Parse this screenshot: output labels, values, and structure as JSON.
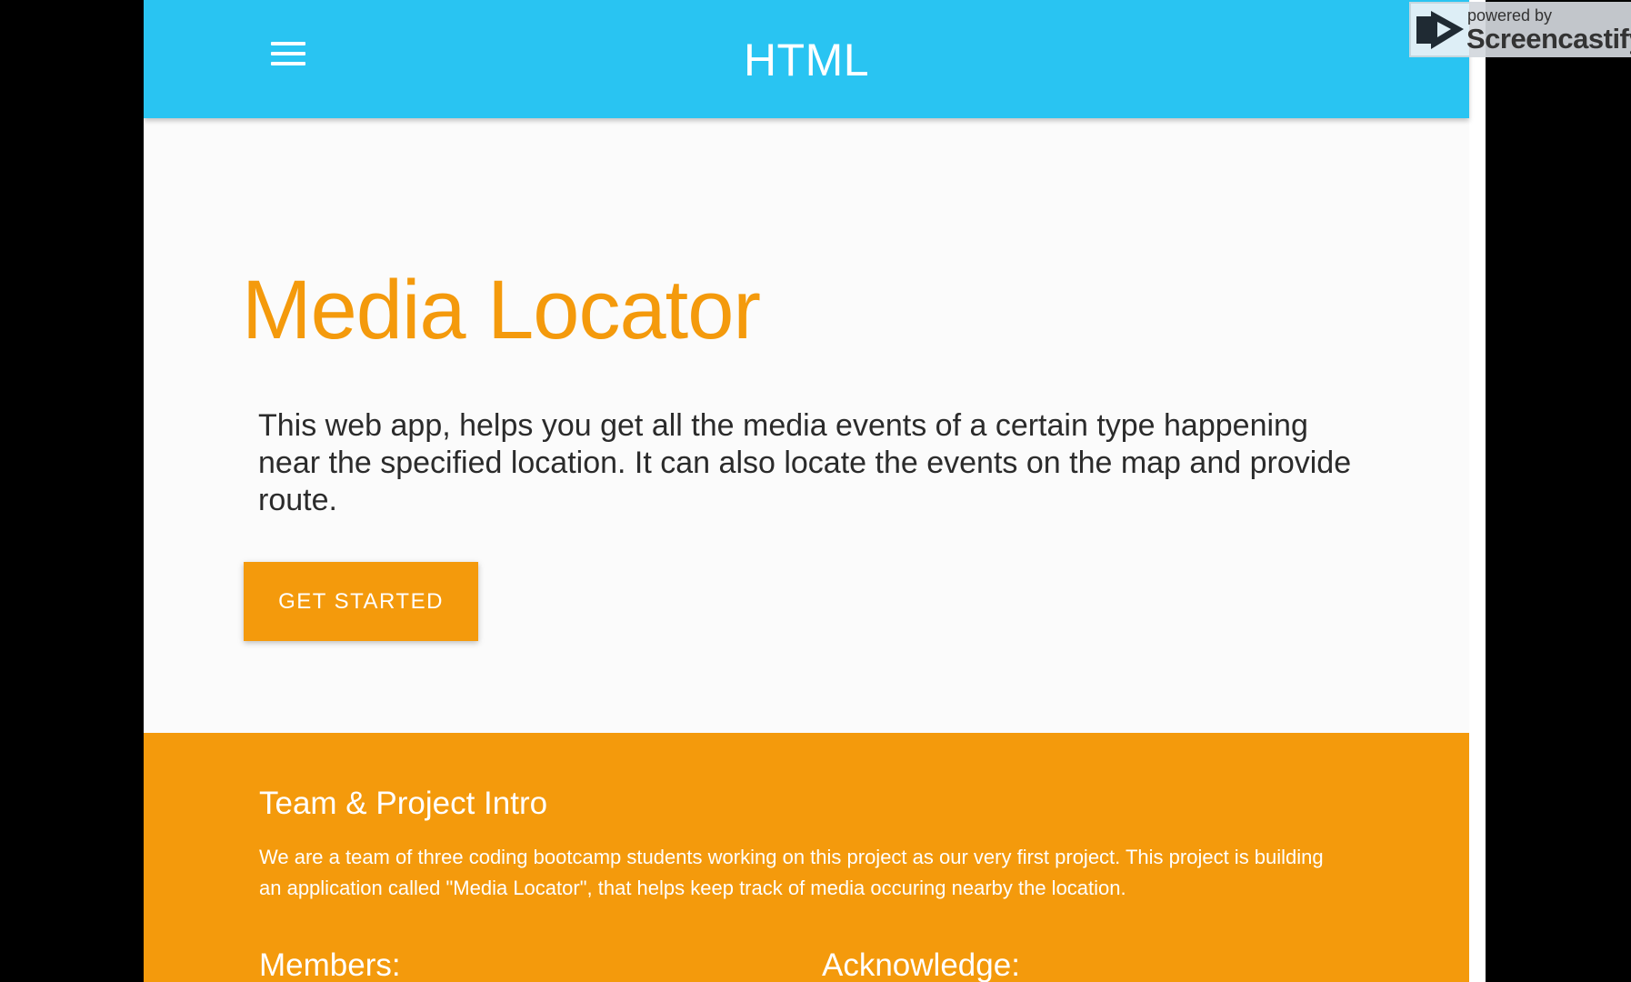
{
  "navbar": {
    "menu_icon": "hamburger-menu-icon",
    "brand": "HTML",
    "background_color": "#29c4f2"
  },
  "hero": {
    "title": "Media Locator",
    "description": "This web app, helps you get all the media events of a certain type happening near the specified location. It can also locate the events on the map and provide route.",
    "cta_label": "GET STARTED",
    "accent_color": "#f49a0c"
  },
  "intro": {
    "title": "Team & Project Intro",
    "text": "We are a team of three coding bootcamp students working on this project as our very first project. This project is building an application called \"Media Locator\", that helps keep track of media occuring nearby the location.",
    "members_heading": "Members:",
    "acknowledge_heading": "Acknowledge:",
    "background_color": "#f49a0c"
  },
  "watermark": {
    "powered_by": "powered by",
    "name": "Screencastify",
    "icon": "screencastify-play-icon"
  }
}
